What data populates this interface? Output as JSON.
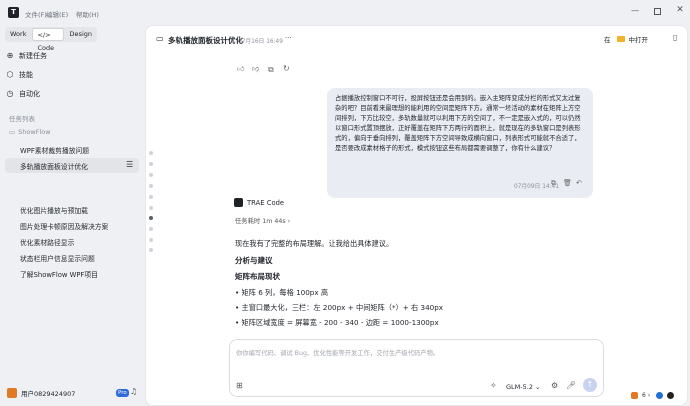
{
  "window": {
    "logo": "T",
    "menu": [
      {
        "label": "文件(F)"
      },
      {
        "label": "编辑(E)"
      },
      {
        "label": "帮助(H)"
      }
    ]
  },
  "sidebar": {
    "modes": [
      {
        "label": "Work"
      },
      {
        "label": "</> Code"
      },
      {
        "label": "Design"
      }
    ],
    "nav": [
      {
        "label": "新建任务",
        "icon": "plus-circle-icon"
      },
      {
        "label": "技能",
        "icon": "cube-icon"
      },
      {
        "label": "自动化",
        "icon": "clock-icon"
      }
    ],
    "section_title": "任务列表",
    "group": "ShowFlow",
    "tasks": [
      "WPF素材裁剪播放问题",
      "多轨播放面板设计优化",
      "优化图片播放与预加载",
      "图片处理卡顿原因及解决方案",
      "优化素材路径显示",
      "状态栏用户信息显示问题",
      "了解ShowFlow WPF项目"
    ],
    "user": "用户0829424907",
    "user_badge": "Pro"
  },
  "header": {
    "title": "多轨播放面板设计优化",
    "timestamp": "07月16日 16:49",
    "more": "···",
    "open_in_prefix": "在",
    "open_in": "中打开"
  },
  "chat": {
    "user_message": "占据播放控制窗口不可行，投屏按钮还是会用到的。嵌入主矩阵变成分栏的形式又太过复杂的吧？目前看来最理想的能利用的空间是矩阵下方。通常一坯活动的素材在矩阵上方空间排列，下方比较空，多轨数量就可以利用下方的空间了，不一定是嵌入式的，可以仍然以窗口形式置顶摆放，正好覆盖在矩阵下方两行的面积上，就是现在的多轨窗口是列表形式的，偏向于垂向排列，覆盖矩阵下方空间导致成横向窗口，列表形式可能就不合适了，是否要改成素材格子的形式，模式按钮这些布局都需要调整了，你有什么建议？",
    "user_time": "07月09日 14:41",
    "assistant_name": "TRAE Code",
    "task_time": "任务耗时 1m 44s",
    "intro": "现在我有了完整的布局理解。让我给出具体建议。",
    "h1": "分析与建议",
    "h2": "矩阵布局现状",
    "bullets": [
      "矩阵 6 列，每格 100px 高",
      "主窗口最大化，三栏：左 200px + 中间矩阵（*）+ 右 340px",
      "矩阵区域宽度 = 屏幕宽 - 200 - 340 - 边距 = 1000-1300px"
    ]
  },
  "input": {
    "placeholder": "你你编写代码、调试 Bug、优化性能等开发工作，交付生产级代码产物。",
    "model": "GLM-5.2"
  },
  "tray": {
    "label": "6"
  }
}
